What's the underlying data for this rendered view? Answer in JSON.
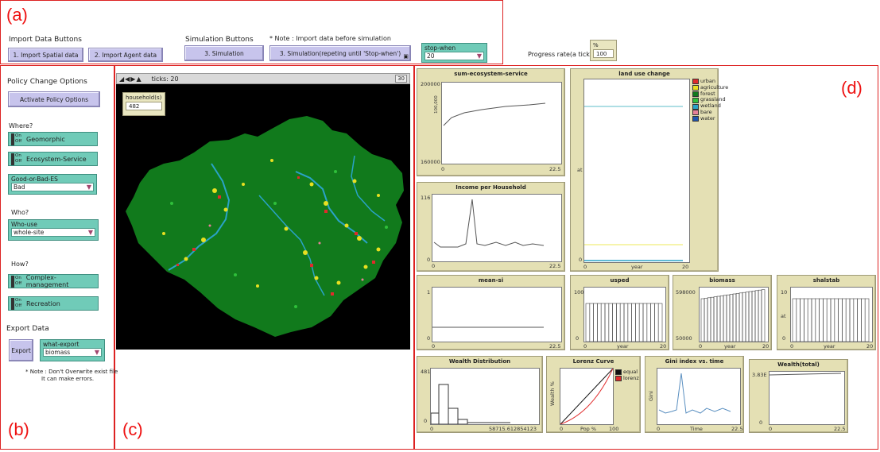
{
  "region_labels": {
    "a": "(a)",
    "b": "(b)",
    "c": "(c)",
    "d": "(d)"
  },
  "import": {
    "title": "Import Data Buttons",
    "btn1": "1. Import Spatial data",
    "btn2": "2. Import Agent data"
  },
  "simulation": {
    "title": "Simulation Buttons",
    "note": "* Note : Import data before simulation",
    "btn3": "3. Simulation",
    "btn3b": "3. Simulation(repeting until 'Stop-when')",
    "stop_label": "stop-when",
    "stop_value": "20"
  },
  "progress": {
    "label": "Progress rate(a tick) :",
    "unit": "%",
    "value": "100"
  },
  "policy": {
    "title": "Policy Change Options",
    "activate": "Activate Policy Options",
    "where": "Where?",
    "sw_geomorphic": "Geomorphic",
    "sw_es": "Ecosystem-Service",
    "good_label": "Good-or-Bad-ES",
    "good_value": "Bad",
    "who": "Who?",
    "who_label": "Who-use",
    "who_value": "whole-site",
    "how": "How?",
    "sw_complex": "Complex-management",
    "sw_recreation": "Recreation",
    "on": "On",
    "off": "Off"
  },
  "export": {
    "title": "Export Data",
    "btn": "Export",
    "what_label": "what-export",
    "what_value": "biomass",
    "note1": "* Note :  Don't Overwrite exist file",
    "note2": "It can make errors."
  },
  "view": {
    "ticks_label": "ticks: 20",
    "speed": "30",
    "household_label": "household(s)",
    "household_value": "482"
  },
  "colors": {
    "urban": "#e02b2b",
    "agriculture": "#e8e020",
    "forest": "#117a1c",
    "grassland": "#2fbf3a",
    "wetland": "#2aa3c7",
    "bare": "#e6809a",
    "water": "#1f56b0",
    "map_bg": "#000000",
    "button": "#c7c4ec",
    "switch": "#70cbb8",
    "plot_bg": "#e4e0b4"
  },
  "plots": {
    "ecosystem": {
      "title": "sum-ecosystem-service",
      "ymax": "200000",
      "ymid": "100,000",
      "ymin": "160000",
      "xmin": "0",
      "xmax": "22.5"
    },
    "landuse": {
      "title": "land use change",
      "xmin": "0",
      "xlabel": "year",
      "xmax": "20",
      "ylabel": "at",
      "ymin": "0",
      "legend": [
        {
          "name": "urban",
          "color": "#e02b2b"
        },
        {
          "name": "agriculture",
          "color": "#e8e020"
        },
        {
          "name": "forest",
          "color": "#117a1c"
        },
        {
          "name": "grassland",
          "color": "#2fbf3a"
        },
        {
          "name": "wetland",
          "color": "#2aa3c7"
        },
        {
          "name": "bare",
          "color": "#e6809a"
        },
        {
          "name": "water",
          "color": "#1f56b0"
        }
      ]
    },
    "income": {
      "title": "Income per Household",
      "ymax": "116",
      "ymin": "0",
      "xmin": "0",
      "xmax": "22.5"
    },
    "meansi": {
      "title": "mean-si",
      "ymax": "1",
      "ymin": "0",
      "xmin": "0",
      "xmax": "22.5"
    },
    "usped": {
      "title": "usped",
      "ymax": "100",
      "ymin": "0",
      "xmin": "0",
      "xlabel": "year",
      "xmax": "20"
    },
    "biomass": {
      "title": "biomass",
      "ymax": "598000",
      "ymin": "50000",
      "xmin": "0",
      "xlabel": "year",
      "xmax": "20"
    },
    "shalstab": {
      "title": "shalstab",
      "ymax": "10",
      "ymin": "0",
      "ylabel": "at",
      "xmin": "0",
      "xlabel": "year",
      "xmax": "20"
    },
    "wealth": {
      "title": "Wealth Distribution",
      "ymax": "481",
      "ymin": "0",
      "xmin": "0",
      "xmax": "58715.612854123"
    },
    "lorenz": {
      "title": "Lorenz Curve",
      "ylabel": "Wealth %",
      "xlabel": "Pop %",
      "xmin": "0",
      "xmax": "100",
      "legend_equal": "equal",
      "legend_lorenz": "lorenz"
    },
    "gini": {
      "title": "Gini index vs. time",
      "ylabel": "Gini",
      "xlabel": "Time",
      "xmin": "0",
      "xmax": "22.5"
    },
    "wealthtotal": {
      "title": "Wealth(total)",
      "ymax": "3.83E",
      "ymin": "0",
      "xmin": "0",
      "xmax": "22.5"
    }
  }
}
